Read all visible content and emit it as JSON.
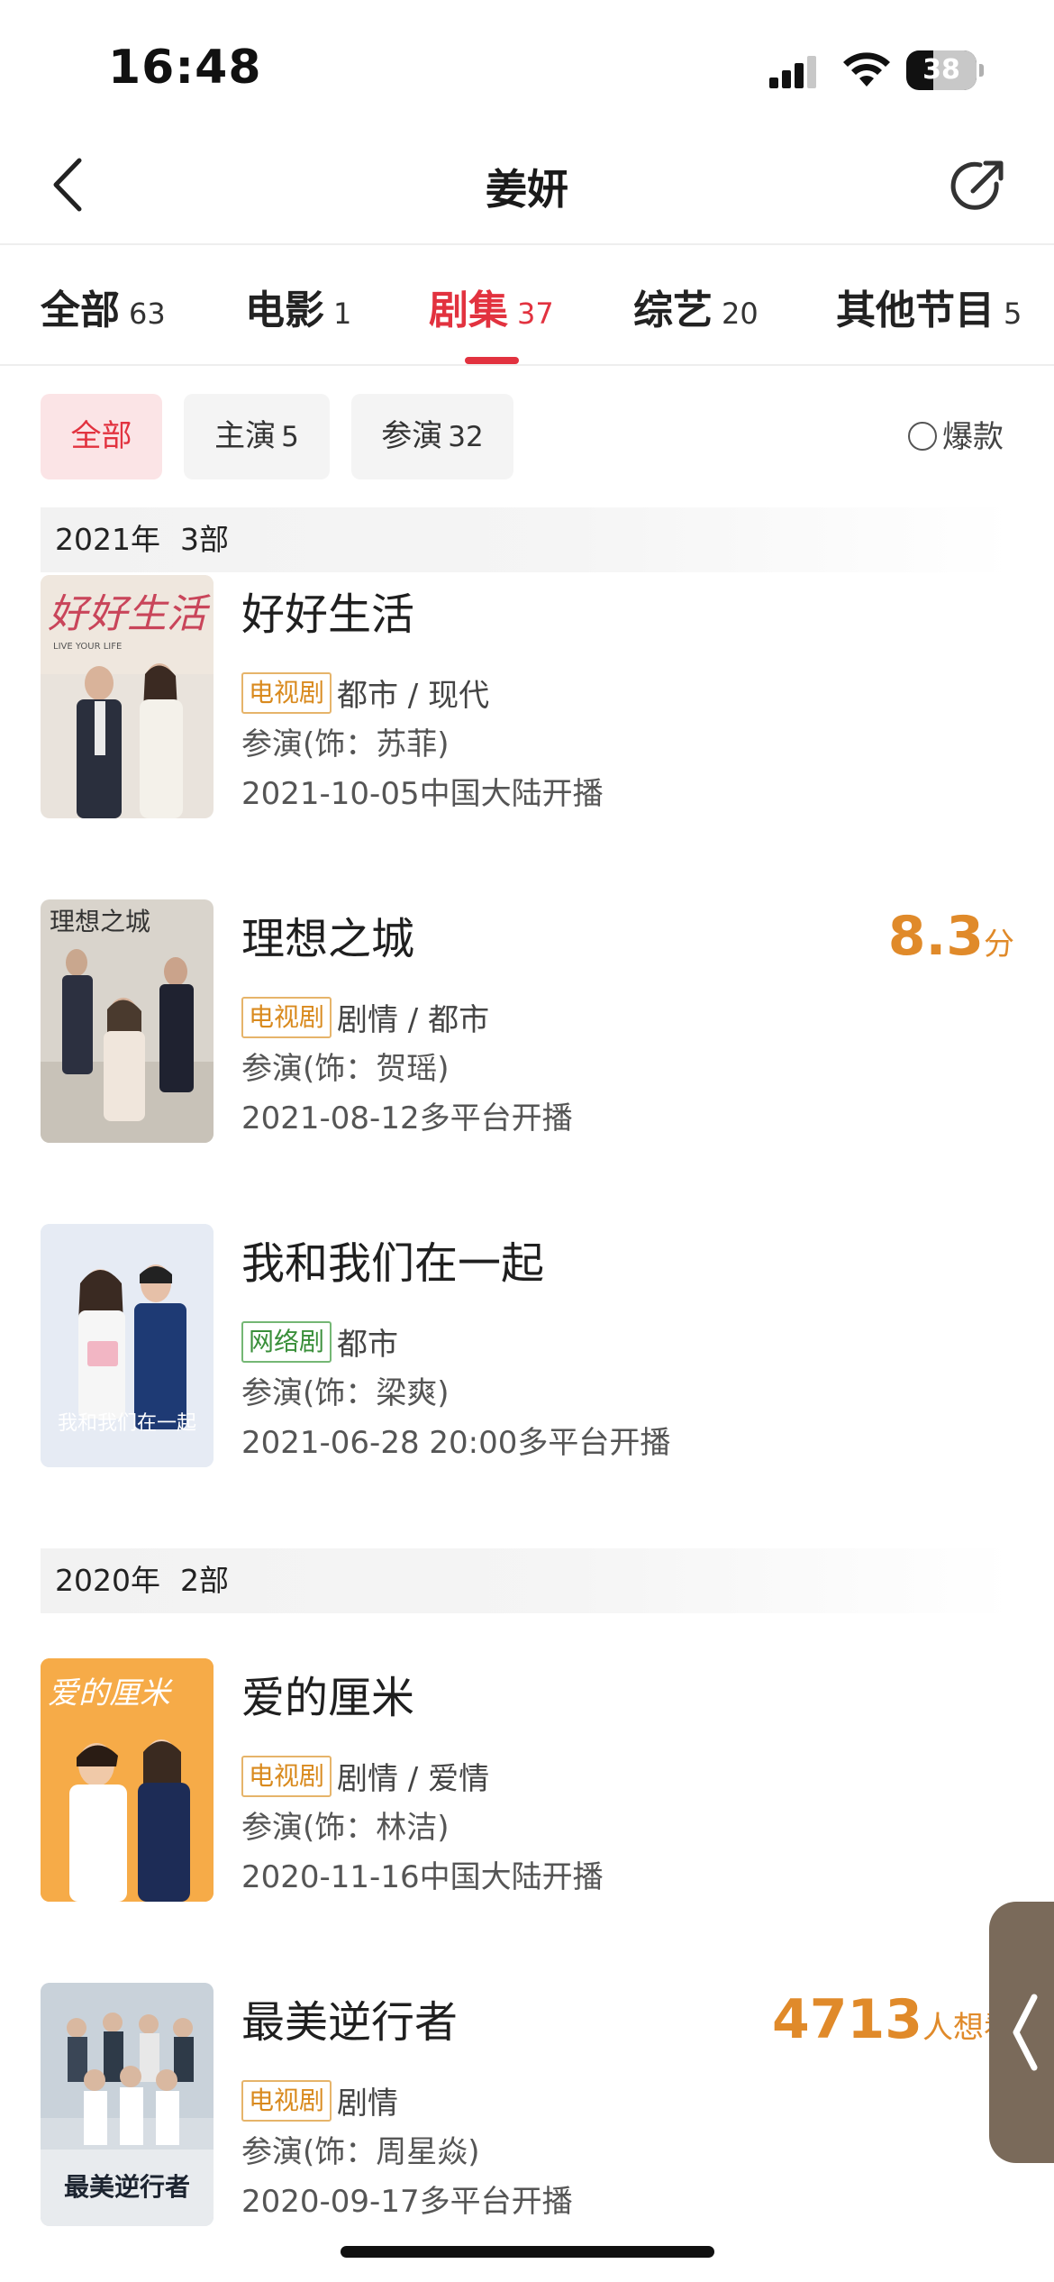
{
  "status_bar": {
    "time": "16:48",
    "battery": "38",
    "battery_level": 0.38
  },
  "nav": {
    "title": "姜妍"
  },
  "tabs": [
    {
      "label": "全部",
      "count": "63"
    },
    {
      "label": "电影",
      "count": "1"
    },
    {
      "label": "剧集",
      "count": "37",
      "active": true
    },
    {
      "label": "综艺",
      "count": "20"
    },
    {
      "label": "其他节目",
      "count": "5"
    }
  ],
  "filters": [
    {
      "label": "全部",
      "count": "",
      "active": true
    },
    {
      "label": "主演",
      "count": "5"
    },
    {
      "label": "参演",
      "count": "32"
    }
  ],
  "hot_toggle": {
    "label": "爆款",
    "checked": false
  },
  "sections": [
    {
      "year": "2021年",
      "count": "3部",
      "items": [
        {
          "title": "好好生活",
          "tag": "电视剧",
          "genre": "都市 / 现代",
          "role": "参演(饰：苏菲)",
          "release": "2021-10-05中国大陆开播",
          "score": "",
          "score_unit": ""
        },
        {
          "title": "理想之城",
          "tag": "电视剧",
          "genre": "剧情 / 都市",
          "role": "参演(饰：贺瑶)",
          "release": "2021-08-12多平台开播",
          "score": "8.3",
          "score_unit": "分"
        },
        {
          "title": "我和我们在一起",
          "tag": "网络剧",
          "genre": "都市",
          "role": "参演(饰：梁爽)",
          "release": "2021-06-28 20:00多平台开播",
          "score": "",
          "score_unit": ""
        }
      ]
    },
    {
      "year": "2020年",
      "count": "2部",
      "items": [
        {
          "title": "爱的厘米",
          "tag": "电视剧",
          "genre": "剧情 / 爱情",
          "role": "参演(饰：林洁)",
          "release": "2020-11-16中国大陆开播",
          "want": "",
          "want_unit": ""
        },
        {
          "title": "最美逆行者",
          "tag": "电视剧",
          "genre": "剧情",
          "role": "参演(饰：周星焱)",
          "release": "2020-09-17多平台开播",
          "want": "4713",
          "want_unit": "人想看"
        }
      ]
    }
  ],
  "poster_texts": {
    "p1": "好好生活",
    "p1_sub": "LIVE YOUR LIFE",
    "p2": "理想之城",
    "p3": "我和我们在一起",
    "p4": "爱的厘米",
    "p5": "最美逆行者"
  },
  "colors": {
    "accent": "#e2323f",
    "score": "#e08a2a",
    "tv_tag": "#d98a1e",
    "web_tag": "#3a8f3a"
  }
}
